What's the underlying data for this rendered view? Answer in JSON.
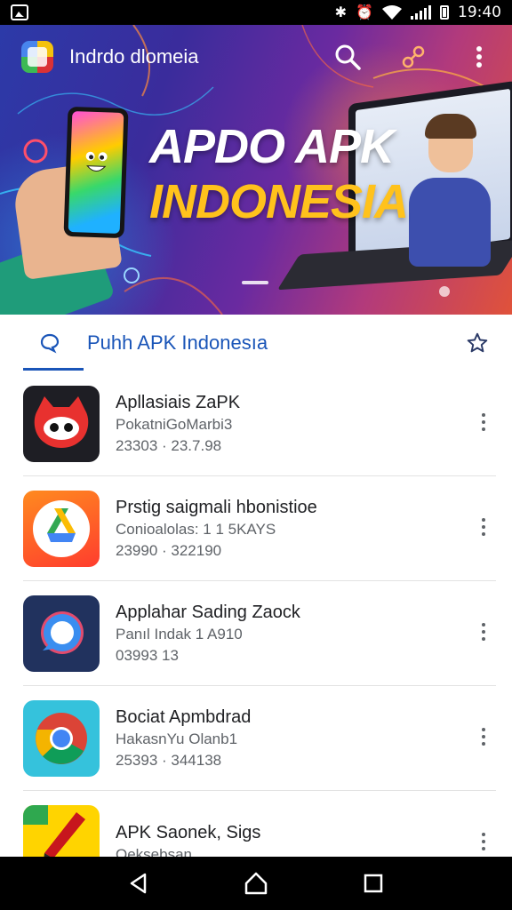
{
  "status_bar": {
    "time": "19:40",
    "icons": [
      "gallery-icon",
      "bluetooth-icon",
      "alarm-icon",
      "wifi-icon",
      "signal-icon",
      "battery-icon"
    ]
  },
  "hero": {
    "app_title": "Indrdo dlomeia",
    "headline_line1": "APDO APK",
    "headline_line2": "INDONESIA",
    "colors": {
      "headline_accent": "#ffc21c",
      "background_start": "#2c3aa8",
      "background_end": "#e0523a"
    }
  },
  "section": {
    "title": "Puhh APK Indonesıa",
    "accent_color": "#1a55b8"
  },
  "apps": [
    {
      "name": "Apllasiais ZaPK",
      "subtitle": "PokatniGoMarbi3",
      "meta": "23303 · 23.7.98",
      "icon": "red-mascot-icon"
    },
    {
      "name": "Prstig saigmali hbonistioe",
      "subtitle": "Conioalolas: 1 1 5KAYS",
      "meta": "23990 · 322190",
      "icon": "drive-icon"
    },
    {
      "name": "Applahar Sading Zaock",
      "subtitle": "Panıl Indak 1 A910",
      "meta": "03993 13",
      "icon": "chat-bubble-icon"
    },
    {
      "name": "Bociat Apmbdrad",
      "subtitle": "HakasnYu Olanb1",
      "meta": "25393 · 344138",
      "icon": "chrome-icon"
    },
    {
      "name": "APK Saonek, Sigs",
      "subtitle": "Oeksebsan",
      "meta": "",
      "icon": "pen-icon"
    }
  ],
  "nav_bar": {
    "buttons": [
      "back-icon",
      "home-icon",
      "recents-icon"
    ]
  }
}
